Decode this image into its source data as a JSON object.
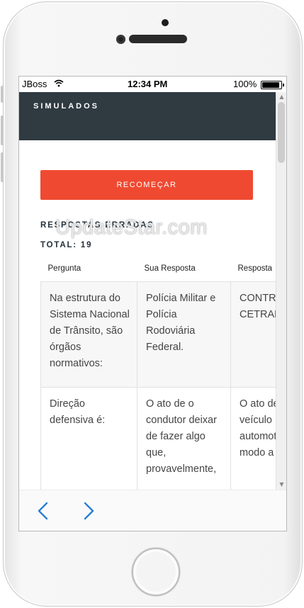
{
  "status_bar": {
    "carrier": "JBoss",
    "wifi_icon": "wifi-icon",
    "time": "12:34 PM",
    "battery_percent": "100%",
    "battery_level": 1.0
  },
  "header": {
    "title": "SIMULADOS"
  },
  "main": {
    "restart_label": "RECOMEÇAR",
    "wrong_answers_title": "RESPOSTAS ERRADAS",
    "total_label": "TOTAL: 19",
    "table": {
      "columns": [
        "Pergunta",
        "Sua Resposta",
        "Resposta"
      ],
      "rows": [
        {
          "question": "Na estrutura do Sistema Nacional de Trânsito, são órgãos normativos:",
          "your_answer": "Polícia Militar e Polícia Rodoviária Federal.",
          "answer": "CONTRAN e CETRAN"
        },
        {
          "question": "Direção defensiva é:",
          "your_answer": "O ato de o condutor deixar de fazer algo que, provavelmente,",
          "answer": "O ato de o veículo automotor de modo a a possi"
        }
      ]
    }
  },
  "watermark": "UpdateStar.com",
  "bottom_nav": {
    "prev_icon": "chevron-left-icon",
    "next_icon": "chevron-right-icon"
  },
  "colors": {
    "header_bg": "#2f3a41",
    "accent": "#ef4a31",
    "nav_arrow": "#2a7fd4"
  }
}
